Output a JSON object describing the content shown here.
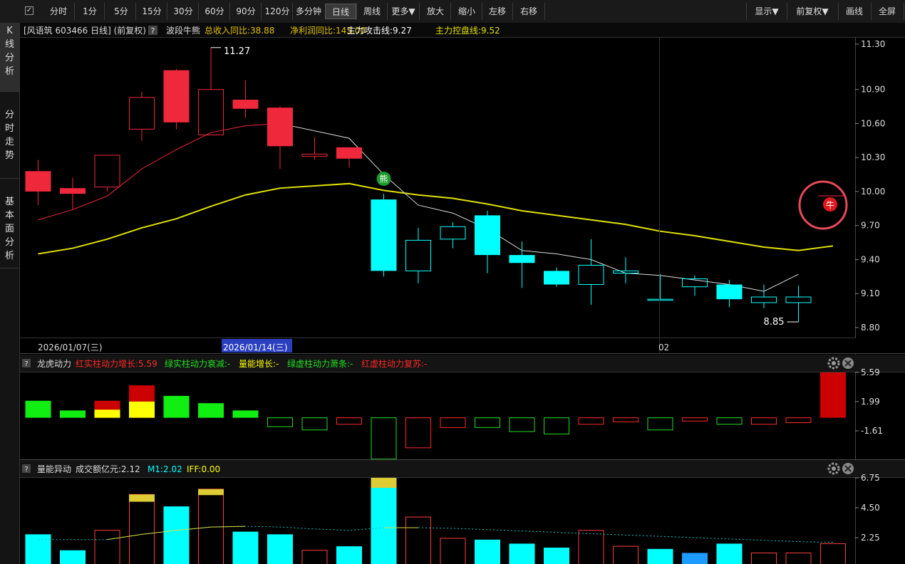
{
  "toolbar": {
    "periods": [
      "分时",
      "1分",
      "5分",
      "15分",
      "30分",
      "60分",
      "90分",
      "120分",
      "多分钟",
      "日线",
      "周线",
      "更多▼"
    ],
    "selected": "日线",
    "actions": [
      "放大",
      "缩小",
      "左移",
      "右移"
    ],
    "right": [
      "显示▼",
      "前复权▼",
      "画线",
      "全屏"
    ]
  },
  "sidebar": [
    "K线分析",
    "分时走势",
    "基本面分析"
  ],
  "main": {
    "header_left": "[风语筑 603466 日线]  (前复权)",
    "help": "?",
    "indicator_name": "波段牛熊",
    "fields": [
      {
        "label": "总收入同比:38.88",
        "color": "#e0c000"
      },
      {
        "label": "净利润同比:145.00",
        "color": "#e0c000"
      },
      {
        "label": "主力攻击线:9.27",
        "color": "#ffffff"
      },
      {
        "label": "主力控盘线:9.52",
        "color": "#e0e000"
      }
    ],
    "max_label": "11.27",
    "min_label": "8.85",
    "bear_marker": "熊",
    "bull_marker": "牛",
    "y_ticks": [
      "11.30",
      "10.90",
      "10.60",
      "10.30",
      "10.00",
      "9.70",
      "9.40",
      "9.10",
      "8.80"
    ],
    "date_labels": [
      "2026/01/07(三)",
      "2026/01/14(三)",
      "02"
    ],
    "colors": {
      "up": "#f0283c",
      "down": "#00ffff",
      "ma_fast": "#ffffff",
      "ma_slow": "#e0e000"
    }
  },
  "chart_data": [
    {
      "type": "candlestick",
      "title": "风语筑 603466 日线",
      "ylim": [
        8.75,
        11.4
      ],
      "candles": [
        {
          "o": 10.0,
          "h": 10.28,
          "l": 9.88,
          "c": 10.18,
          "up": false,
          "filled": true
        },
        {
          "o": 10.03,
          "h": 10.12,
          "l": 9.84,
          "c": 9.98,
          "up": false,
          "filled": true
        },
        {
          "o": 10.04,
          "h": 10.32,
          "l": 10.0,
          "c": 10.32,
          "up": true,
          "filled": false
        },
        {
          "o": 10.55,
          "h": 10.88,
          "l": 10.45,
          "c": 10.83,
          "up": true,
          "filled": false
        },
        {
          "o": 10.61,
          "h": 11.08,
          "l": 10.55,
          "c": 11.07,
          "up": true,
          "filled": true
        },
        {
          "o": 10.5,
          "h": 11.27,
          "l": 10.5,
          "c": 10.9,
          "up": true,
          "filled": false
        },
        {
          "o": 10.73,
          "h": 10.98,
          "l": 10.65,
          "c": 10.81,
          "up": false,
          "filled": true
        },
        {
          "o": 10.4,
          "h": 10.75,
          "l": 10.2,
          "c": 10.74,
          "up": false,
          "filled": true
        },
        {
          "o": 10.31,
          "h": 10.48,
          "l": 10.28,
          "c": 10.33,
          "up": true,
          "filled": false
        },
        {
          "o": 10.29,
          "h": 10.39,
          "l": 10.21,
          "c": 10.39,
          "up": false,
          "filled": true
        },
        {
          "o": 9.93,
          "h": 9.98,
          "l": 9.25,
          "c": 9.3,
          "up": false,
          "filled": true
        },
        {
          "o": 9.3,
          "h": 9.68,
          "l": 9.19,
          "c": 9.57,
          "up": true,
          "filled": false
        },
        {
          "o": 9.58,
          "h": 9.73,
          "l": 9.5,
          "c": 9.69,
          "up": true,
          "filled": false
        },
        {
          "o": 9.79,
          "h": 9.83,
          "l": 9.28,
          "c": 9.44,
          "up": false,
          "filled": true
        },
        {
          "o": 9.44,
          "h": 9.56,
          "l": 9.15,
          "c": 9.37,
          "up": false,
          "filled": true
        },
        {
          "o": 9.3,
          "h": 9.33,
          "l": 9.16,
          "c": 9.18,
          "up": false,
          "filled": true
        },
        {
          "o": 9.18,
          "h": 9.58,
          "l": 9.0,
          "c": 9.35,
          "up": true,
          "filled": false
        },
        {
          "o": 9.28,
          "h": 9.42,
          "l": 9.19,
          "c": 9.3,
          "up": true,
          "filled": false
        },
        {
          "o": 9.04,
          "h": 9.27,
          "l": 9.04,
          "c": 9.05,
          "up": true,
          "filled": false
        },
        {
          "o": 9.16,
          "h": 9.26,
          "l": 9.08,
          "c": 9.23,
          "up": true,
          "filled": false
        },
        {
          "o": 9.18,
          "h": 9.22,
          "l": 8.98,
          "c": 9.05,
          "up": false,
          "filled": true
        },
        {
          "o": 9.02,
          "h": 9.18,
          "l": 8.97,
          "c": 9.07,
          "up": false,
          "filled": false
        },
        {
          "o": 9.02,
          "h": 9.17,
          "l": 8.85,
          "c": 9.07,
          "up": false,
          "filled": false
        }
      ],
      "ma_fast": [
        9.75,
        9.84,
        9.96,
        10.2,
        10.37,
        10.52,
        10.58,
        10.6,
        null,
        10.47,
        10.15,
        9.88,
        9.81,
        9.67,
        9.48,
        9.45,
        9.4,
        9.28,
        9.26,
        9.22,
        9.18,
        9.12,
        9.27
      ],
      "ma_slow": [
        9.45,
        9.5,
        9.58,
        9.68,
        9.76,
        9.87,
        9.97,
        10.03,
        10.05,
        10.07,
        10.01,
        9.97,
        9.94,
        9.89,
        9.83,
        9.79,
        9.75,
        9.71,
        9.65,
        9.61,
        9.56,
        9.51,
        9.48,
        9.52
      ]
    },
    {
      "type": "bar",
      "title": "龙虎动力",
      "legend": [
        {
          "label": "红实柱动力增长:5.59",
          "color": "#ff2828"
        },
        {
          "label": "绿实柱动力衰减:-",
          "color": "#22dd22"
        },
        {
          "label": "量能增长:-",
          "color": "#ffff00"
        },
        {
          "label": "绿虚柱动力萧条:-",
          "color": "#22dd22"
        },
        {
          "label": "红虚柱动力复苏:-",
          "color": "#ff2828"
        }
      ],
      "y_ticks": [
        "5.59",
        "1.99",
        "-1.61"
      ],
      "ylim": [
        -4.0,
        5.59
      ],
      "bars": [
        {
          "v": 2.1,
          "kind": "green_solid"
        },
        {
          "v": 0.9,
          "kind": "green_solid"
        },
        {
          "v": 2.1,
          "kind": "red_solid",
          "yellow": 1.0
        },
        {
          "v": 4.0,
          "kind": "red_solid",
          "yellow": 2.0
        },
        {
          "v": 2.7,
          "kind": "green_solid"
        },
        {
          "v": 1.8,
          "kind": "green_solid"
        },
        {
          "v": 0.9,
          "kind": "green_solid"
        },
        {
          "v": -1.1,
          "kind": "green_hollow"
        },
        {
          "v": -1.5,
          "kind": "green_hollow"
        },
        {
          "v": -0.8,
          "kind": "red_hollow"
        },
        {
          "v": -5.1,
          "kind": "green_hollow"
        },
        {
          "v": -3.7,
          "kind": "red_hollow"
        },
        {
          "v": -1.2,
          "kind": "red_hollow"
        },
        {
          "v": -1.2,
          "kind": "green_hollow"
        },
        {
          "v": -1.7,
          "kind": "green_hollow"
        },
        {
          "v": -2.0,
          "kind": "green_hollow"
        },
        {
          "v": -0.8,
          "kind": "red_hollow"
        },
        {
          "v": -0.5,
          "kind": "red_hollow"
        },
        {
          "v": -1.5,
          "kind": "green_hollow"
        },
        {
          "v": -0.4,
          "kind": "red_hollow"
        },
        {
          "v": -0.8,
          "kind": "green_hollow"
        },
        {
          "v": -0.8,
          "kind": "red_hollow"
        },
        {
          "v": -0.6,
          "kind": "red_hollow"
        },
        {
          "v": 5.59,
          "kind": "red_solid"
        }
      ]
    },
    {
      "type": "bar",
      "title": "量能异动",
      "legend": [
        {
          "label": "成交额亿元:2.12",
          "color": "#dddddd"
        },
        {
          "label": "M1:2.02",
          "color": "#00ffff"
        },
        {
          "label": "IFF:0.00",
          "color": "#ffff00"
        }
      ],
      "y_ticks": [
        "6.75",
        "4.50",
        "2.25"
      ],
      "ylim": [
        0,
        7.2
      ],
      "bars": [
        {
          "v": 2.5,
          "kind": "cyan"
        },
        {
          "v": 1.3,
          "kind": "cyan"
        },
        {
          "v": 2.8,
          "kind": "red_hollow"
        },
        {
          "v": 5.5,
          "kind": "red_hollow",
          "yellow": 0.55
        },
        {
          "v": 4.6,
          "kind": "cyan"
        },
        {
          "v": 5.9,
          "kind": "red_hollow",
          "yellow": 0.45
        },
        {
          "v": 2.7,
          "kind": "cyan"
        },
        {
          "v": 2.5,
          "kind": "cyan"
        },
        {
          "v": 1.3,
          "kind": "red_hollow"
        },
        {
          "v": 1.6,
          "kind": "cyan"
        },
        {
          "v": 6.9,
          "kind": "cyan",
          "yellow": 0.75
        },
        {
          "v": 3.8,
          "kind": "red_hollow"
        },
        {
          "v": 2.2,
          "kind": "red_hollow"
        },
        {
          "v": 2.1,
          "kind": "cyan"
        },
        {
          "v": 1.8,
          "kind": "cyan"
        },
        {
          "v": 1.5,
          "kind": "cyan"
        },
        {
          "v": 2.8,
          "kind": "red_hollow"
        },
        {
          "v": 1.6,
          "kind": "red_hollow"
        },
        {
          "v": 1.4,
          "kind": "cyan"
        },
        {
          "v": 1.1,
          "kind": "blue"
        },
        {
          "v": 1.8,
          "kind": "cyan"
        },
        {
          "v": 1.1,
          "kind": "red_hollow"
        },
        {
          "v": 1.1,
          "kind": "red_hollow"
        },
        {
          "v": 1.8,
          "kind": "red_hollow"
        }
      ],
      "m1_line": [
        2.1,
        2.1,
        2.1,
        2.5,
        2.8,
        3.05,
        3.1,
        3.05,
        2.9,
        2.8,
        3.0,
        3.0,
        2.95,
        2.85,
        2.75,
        2.65,
        2.55,
        2.45,
        2.35,
        2.25,
        2.15,
        2.05,
        1.95,
        1.9
      ],
      "iff_segments": [
        [
          2,
          3,
          4,
          5,
          6
        ],
        [
          10,
          11
        ]
      ]
    }
  ]
}
